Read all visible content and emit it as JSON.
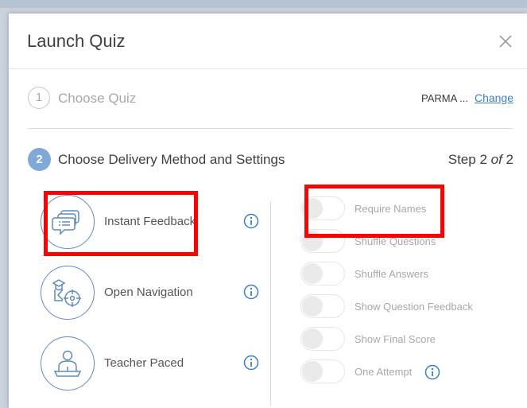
{
  "modal": {
    "title": "Launch Quiz"
  },
  "step1": {
    "number": "1",
    "label": "Choose Quiz",
    "quiz_name": "PARMA ...",
    "change_label": "Change"
  },
  "step2": {
    "number": "2",
    "label": "Choose Delivery Method and Settings",
    "step_prefix": "Step 2 ",
    "step_of": "of",
    "step_suffix": " 2"
  },
  "delivery_methods": [
    {
      "label": "Instant Feedback",
      "icon": "chat-bubbles-icon"
    },
    {
      "label": "Open Navigation",
      "icon": "navigation-map-icon"
    },
    {
      "label": "Teacher Paced",
      "icon": "teacher-icon"
    }
  ],
  "settings": [
    {
      "label": "Require Names",
      "enabled": false
    },
    {
      "label": "Shuffle Questions",
      "enabled": false
    },
    {
      "label": "Shuffle Answers",
      "enabled": false
    },
    {
      "label": "Show Question Feedback",
      "enabled": false
    },
    {
      "label": "Show Final Score",
      "enabled": false
    },
    {
      "label": "One Attempt",
      "enabled": false
    }
  ],
  "colors": {
    "accent": "#3b7fc4",
    "icon_blue": "#5f8bb7",
    "step_badge": "#7fa9d6",
    "highlight": "#ff0000"
  }
}
